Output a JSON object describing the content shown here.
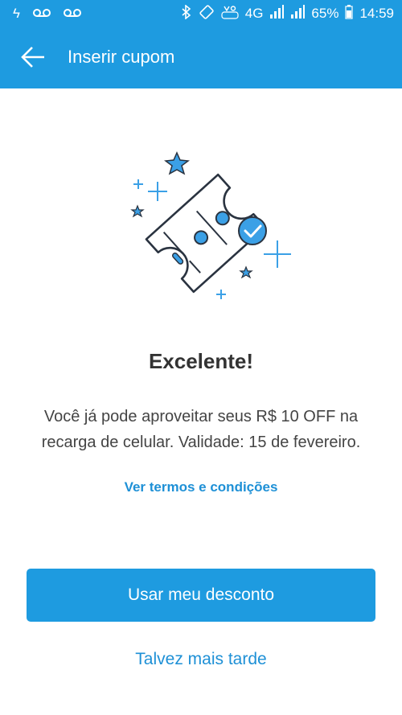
{
  "colors": {
    "brand": "#1e9be0",
    "link": "#1e90d6",
    "text": "#333333"
  },
  "status_bar": {
    "left_icons": [
      "flash-icon",
      "voicemail-icon",
      "voicemail-icon"
    ],
    "right_icons": [
      "bluetooth-icon",
      "vibrate-icon",
      "volte-icon",
      "signal-icon",
      "signal-icon",
      "battery-icon"
    ],
    "network": "4G",
    "battery": "65%",
    "time": "14:59"
  },
  "app_bar": {
    "title": "Inserir cupom"
  },
  "content": {
    "headline": "Excelente!",
    "message": "Você já pode aproveitar seus R$ 10 OFF na recarga de celular. Validade: 15 de fevereiro.",
    "terms_link": "Ver termos e condições"
  },
  "actions": {
    "primary": "Usar meu desconto",
    "secondary": "Talvez mais tarde"
  }
}
